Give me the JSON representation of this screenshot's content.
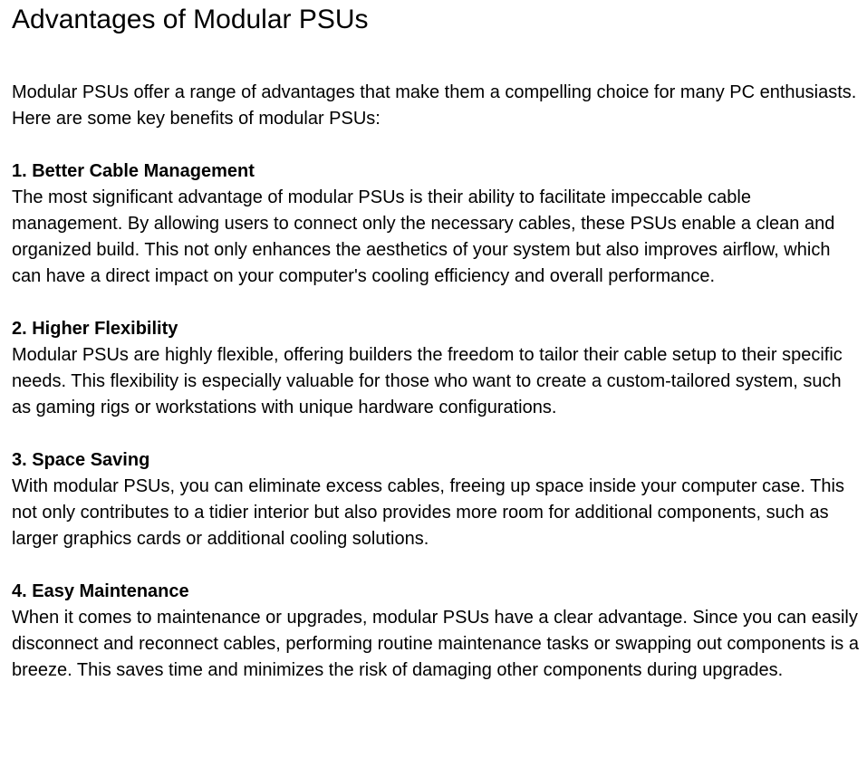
{
  "document": {
    "title": "Advantages of Modular PSUs",
    "intro": "Modular PSUs offer a range of advantages that make them a compelling choice for many PC enthusiasts. Here are some key benefits of modular PSUs:",
    "sections": [
      {
        "heading": "1. Better Cable Management",
        "body": "The most significant advantage of modular PSUs is their ability to facilitate impeccable cable management. By allowing users to connect only the necessary cables, these PSUs enable a clean and organized build. This not only enhances the aesthetics of your system but also improves airflow, which can have a direct impact on your computer's cooling efficiency and overall performance."
      },
      {
        "heading": "2. Higher Flexibility",
        "body": "Modular PSUs are highly flexible, offering builders the freedom to tailor their cable setup to their specific needs. This flexibility is especially valuable for those who want to create a custom-tailored system, such as gaming rigs or workstations with unique hardware configurations."
      },
      {
        "heading": "3. Space Saving",
        "body": "With modular PSUs, you can eliminate excess cables, freeing up space inside your computer case. This not only contributes to a tidier interior but also provides more room for additional components, such as larger graphics cards or additional cooling solutions."
      },
      {
        "heading": "4. Easy Maintenance",
        "body": "When it comes to maintenance or upgrades, modular PSUs have a clear advantage. Since you can easily disconnect and reconnect cables, performing routine maintenance tasks or swapping out components is a breeze. This saves time and minimizes the risk of damaging other components during upgrades."
      }
    ]
  }
}
